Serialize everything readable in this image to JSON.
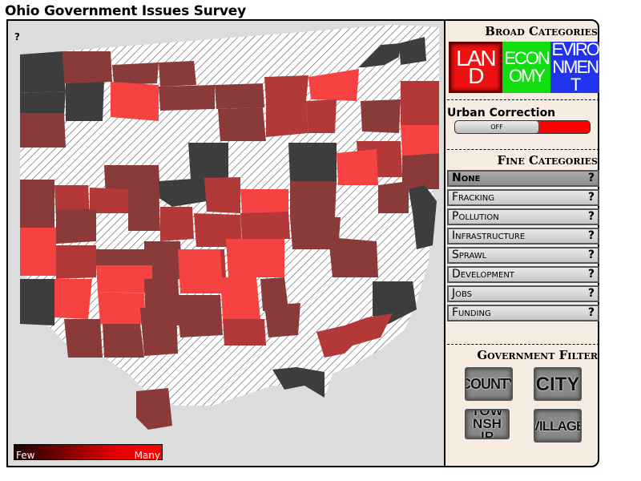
{
  "title": "Ohio Government Issues Survey",
  "map": {
    "help": "?",
    "legend": {
      "few": "Few",
      "many": "Many"
    },
    "colors": {
      "dark": "#3d3d3d",
      "maroon": "#8b3a3a",
      "medium": "#b33838",
      "bright": "#f74242"
    }
  },
  "panel": {
    "broad_title": "Broad Categories",
    "broad": [
      {
        "label": "LAND",
        "color": "#ee1111",
        "selected": true
      },
      {
        "label": "ECONOMY",
        "color": "#11dd11",
        "selected": false
      },
      {
        "label": "EVIRONMENT",
        "color": "#2233ee",
        "selected": false
      }
    ],
    "urban_label": "Urban Correction",
    "toggle_state": "OFF",
    "fine_title": "Fine Categories",
    "fine": [
      {
        "label": "None",
        "help": "?",
        "selected": true
      },
      {
        "label": "Fracking",
        "help": "?",
        "selected": false
      },
      {
        "label": "Pollution",
        "help": "?",
        "selected": false
      },
      {
        "label": "Infrastructure",
        "help": "?",
        "selected": false
      },
      {
        "label": "Sprawl",
        "help": "?",
        "selected": false
      },
      {
        "label": "Development",
        "help": "?",
        "selected": false
      },
      {
        "label": "Jobs",
        "help": "?",
        "selected": false
      },
      {
        "label": "Funding",
        "help": "?",
        "selected": false
      }
    ],
    "gov_title": "Government Filter",
    "gov": [
      {
        "label": "COUNTY"
      },
      {
        "label": "CITY"
      },
      {
        "label": "TOWNSHIP"
      },
      {
        "label": "VILLAGE"
      }
    ]
  }
}
